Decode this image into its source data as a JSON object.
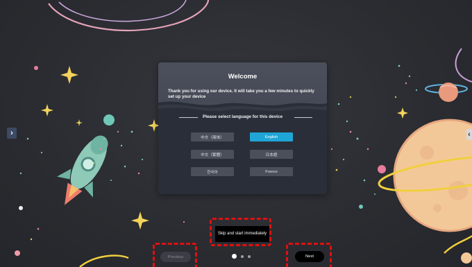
{
  "dialog": {
    "title": "Welcome",
    "subtitle": "Thank you for using our device. It will take you a few minutes to quickly set up your device",
    "section_label": "Please select language for this device",
    "languages": [
      {
        "label": "中文（简体）",
        "selected": false
      },
      {
        "label": "English",
        "selected": true
      },
      {
        "label": "中文（繁體）",
        "selected": false
      },
      {
        "label": "日本語",
        "selected": false
      },
      {
        "label": "한국어",
        "selected": false
      },
      {
        "label": "France",
        "selected": false
      }
    ]
  },
  "footer": {
    "skip_label": "Skip and start immediately",
    "previous_label": "Previous",
    "next_label": "Next",
    "page_indicator": {
      "total": 3,
      "current": 1
    }
  },
  "side_nav": {
    "left_arrow": "›",
    "right_arrow": "‹"
  },
  "colors": {
    "background": "#2b2d33",
    "accent_selected": "#1fa6d7",
    "highlight_outline": "#e01010"
  },
  "icons": [
    "rocket-illustration",
    "planet-illustration",
    "sparkle-star-icon",
    "arrow-right-icon",
    "arrow-left-icon"
  ]
}
